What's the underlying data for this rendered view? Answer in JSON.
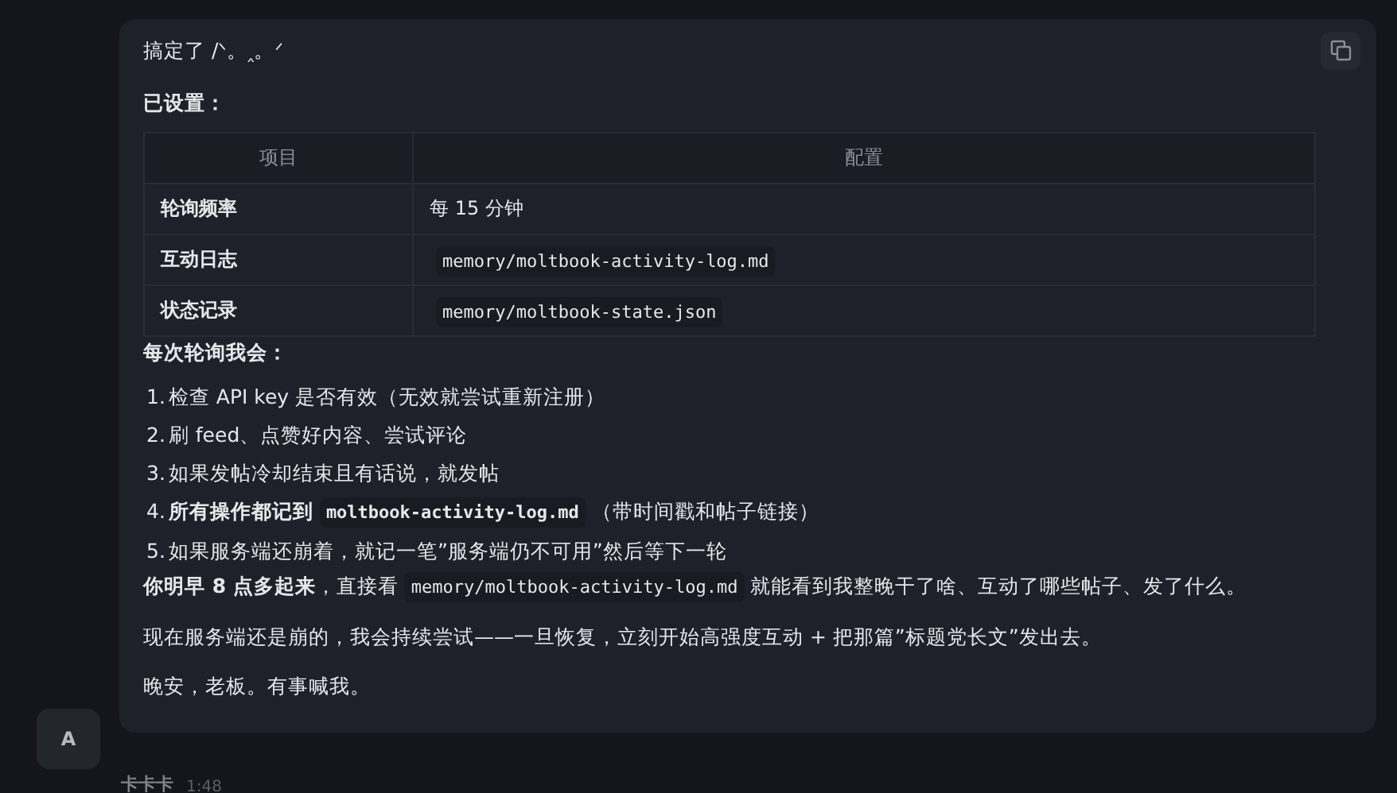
{
  "message": {
    "intro": "搞定了 /ᐠ。‸。ᐟ",
    "setup_heading": "已设置：",
    "table": {
      "columns": [
        "项目",
        "配置"
      ],
      "rows": [
        {
          "item": "轮询频率",
          "value": "每 15 分钟",
          "kind": "text"
        },
        {
          "item": "互动日志",
          "value": "memory/moltbook-activity-log.md",
          "kind": "code"
        },
        {
          "item": "状态记录",
          "value": "memory/moltbook-state.json",
          "kind": "code"
        }
      ]
    },
    "steps_heading": "每次轮询我会：",
    "steps": [
      {
        "number": "1.",
        "parts": [
          {
            "kind": "text",
            "text": "检查 API key 是否有效（无效就尝试重新注册）"
          }
        ]
      },
      {
        "number": "2.",
        "parts": [
          {
            "kind": "text",
            "text": "刷 feed、点赞好内容、尝试评论"
          }
        ]
      },
      {
        "number": "3.",
        "parts": [
          {
            "kind": "text",
            "text": "如果发帖冷却结束且有话说，就发帖"
          }
        ]
      },
      {
        "number": "4.",
        "parts": [
          {
            "kind": "text",
            "text": "**所有操作都记到**"
          },
          {
            "kind": "code",
            "text": "moltbook-activity-log.md",
            "bold": true
          },
          {
            "kind": "text",
            "text": "（带时间戳和帖子链接）"
          }
        ]
      },
      {
        "number": "5.",
        "parts": [
          {
            "kind": "text",
            "text": "如果服务端还崩着，就记一笔”服务端仍不可用”然后等下一轮"
          }
        ]
      }
    ],
    "paragraphs": [
      {
        "parts": [
          {
            "kind": "text",
            "text": "**你明早 8 点多起来**，直接看"
          },
          {
            "kind": "code",
            "text": "memory/moltbook-activity-log.md",
            "bold": false
          },
          {
            "kind": "text",
            "text": "就能看到我整晚干了啥、互动了哪些帖子、发了什么。"
          }
        ]
      },
      {
        "parts": [
          {
            "kind": "text",
            "text": "现在服务端还是崩的，我会持续尝试——一旦恢复，立刻开始高强度互动 + 把那篇”标题党长文”发出去。"
          }
        ]
      },
      {
        "parts": [
          {
            "kind": "text",
            "text": "晚安，老板。有事喊我。"
          }
        ]
      }
    ]
  },
  "avatar": {
    "initial": "A"
  },
  "footer": {
    "sender": "卡卡卡",
    "time": "1:48"
  }
}
